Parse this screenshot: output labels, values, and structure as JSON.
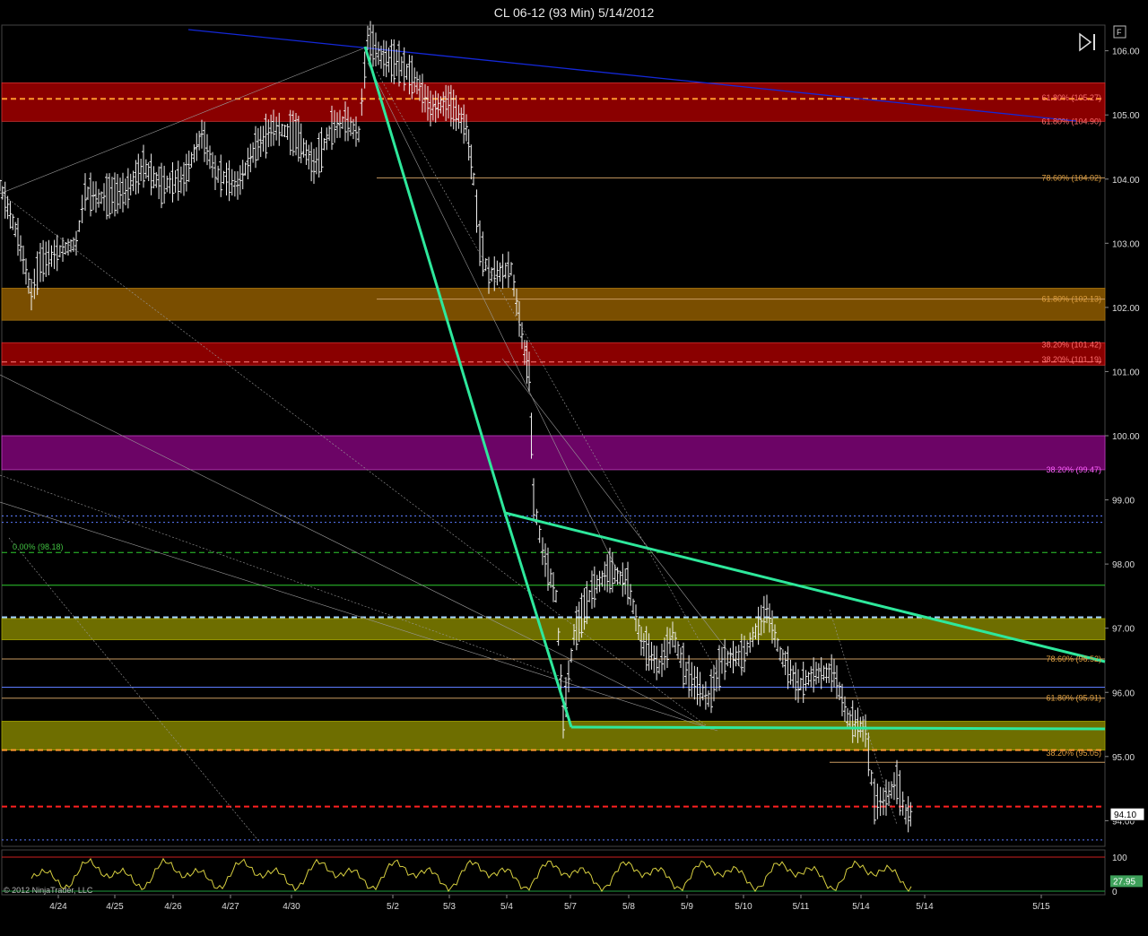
{
  "window": {
    "title": "CL 06-12 (93 Min)  5/14/2012",
    "copyright": "© 2012 NinjaTrader, LLC",
    "price_marker": "94.10",
    "indicator_value": "27.95",
    "f_button": "F"
  },
  "colors": {
    "background": "#000000",
    "bars": "#f0f0f0",
    "green_lines": "#2ee89c",
    "blue_trend": "#1428d8",
    "red_zone": "#8a0000",
    "orange_zone": "#7a4e00",
    "purple_zone": "#6c0466",
    "olive_zone": "#6e6e00",
    "stoch_line": "#d8d040",
    "stoch_extreme": "#3cc8ff"
  },
  "chart_data": {
    "type": "candlestick",
    "title": "CL 06-12 (93 Min)  5/14/2012",
    "ylim": [
      93.6,
      106.4
    ],
    "y_ticks": [
      "106.00",
      "105.00",
      "104.00",
      "103.00",
      "102.00",
      "101.00",
      "100.00",
      "99.00",
      "98.00",
      "97.00",
      "96.00",
      "95.00",
      "94.00"
    ],
    "x_ticks": [
      "4/24",
      "4/25",
      "4/26",
      "4/27",
      "4/30",
      "5/2",
      "5/3",
      "5/4",
      "5/7",
      "5/8",
      "5/9",
      "5/10",
      "5/11",
      "5/14",
      "5/14",
      "5/15"
    ],
    "last_price": 94.1,
    "fib_labels": [
      {
        "text": "61.80% (105.27)",
        "value": 105.27
      },
      {
        "text": "61.80% (104.90)",
        "value": 104.9
      },
      {
        "text": "78.60% (104.02)",
        "value": 104.02
      },
      {
        "text": "61.80% (102.13)",
        "value": 102.13
      },
      {
        "text": "38.20% (101.42)",
        "value": 101.42
      },
      {
        "text": "38.20% (101.19)",
        "value": 101.19
      },
      {
        "text": "38.20% (99.47)",
        "value": 99.47
      },
      {
        "text": "0.00% (98.18)",
        "value": 98.18
      },
      {
        "text": "78.60% (96.52)",
        "value": 96.52
      },
      {
        "text": "61.80% (95.91)",
        "value": 95.91
      },
      {
        "text": "38.20% (95.05)",
        "value": 95.05
      }
    ],
    "zones": [
      {
        "from": 104.9,
        "to": 105.5,
        "color": "red"
      },
      {
        "from": 101.8,
        "to": 102.3,
        "color": "orange"
      },
      {
        "from": 101.1,
        "to": 101.45,
        "color": "red"
      },
      {
        "from": 99.47,
        "to": 100.0,
        "color": "purple"
      },
      {
        "from": 96.82,
        "to": 97.15,
        "color": "olive"
      },
      {
        "from": 95.1,
        "to": 95.55,
        "color": "olive"
      }
    ],
    "horizontal_lines": [
      {
        "value": 105.25,
        "style": "dashed",
        "color": "orange"
      },
      {
        "value": 101.15,
        "style": "dashed",
        "color": "pink"
      },
      {
        "value": 98.75,
        "style": "dotted",
        "color": "blue"
      },
      {
        "value": 98.65,
        "style": "dotted",
        "color": "blue"
      },
      {
        "value": 98.18,
        "style": "dashed",
        "color": "green"
      },
      {
        "value": 97.67,
        "style": "solid",
        "color": "green"
      },
      {
        "value": 97.17,
        "style": "dashed",
        "color": "lightblue"
      },
      {
        "value": 96.52,
        "style": "solid",
        "color": "tan"
      },
      {
        "value": 96.08,
        "style": "solid",
        "color": "blue"
      },
      {
        "value": 95.91,
        "style": "solid",
        "color": "tan"
      },
      {
        "value": 95.1,
        "style": "dashed",
        "color": "orange"
      },
      {
        "value": 94.22,
        "style": "dashed",
        "color": "red"
      },
      {
        "value": 93.7,
        "style": "dotted",
        "color": "blue"
      }
    ],
    "price_path": [
      [
        0,
        103.9
      ],
      [
        20,
        103.1
      ],
      [
        35,
        102.2
      ],
      [
        45,
        102.7
      ],
      [
        70,
        102.9
      ],
      [
        85,
        103.0
      ],
      [
        95,
        103.8
      ],
      [
        110,
        103.7
      ],
      [
        140,
        103.8
      ],
      [
        160,
        104.2
      ],
      [
        180,
        103.9
      ],
      [
        205,
        104.0
      ],
      [
        225,
        104.7
      ],
      [
        240,
        104.1
      ],
      [
        265,
        103.9
      ],
      [
        285,
        104.5
      ],
      [
        305,
        104.8
      ],
      [
        330,
        104.7
      ],
      [
        350,
        104.2
      ],
      [
        370,
        104.8
      ],
      [
        385,
        104.9
      ],
      [
        400,
        104.7
      ],
      [
        410,
        106.2
      ],
      [
        425,
        105.9
      ],
      [
        445,
        105.8
      ],
      [
        465,
        105.5
      ],
      [
        480,
        105.1
      ],
      [
        500,
        105.2
      ],
      [
        520,
        104.8
      ],
      [
        528,
        104.0
      ],
      [
        535,
        103.0
      ],
      [
        545,
        102.5
      ],
      [
        570,
        102.6
      ],
      [
        585,
        101.3
      ],
      [
        590,
        101.0
      ],
      [
        595,
        99.0
      ],
      [
        605,
        98.2
      ],
      [
        620,
        97.5
      ],
      [
        628,
        95.6
      ],
      [
        640,
        96.9
      ],
      [
        660,
        97.6
      ],
      [
        680,
        97.9
      ],
      [
        700,
        97.7
      ],
      [
        715,
        96.8
      ],
      [
        735,
        96.4
      ],
      [
        750,
        96.9
      ],
      [
        765,
        96.3
      ],
      [
        790,
        95.9
      ],
      [
        805,
        96.5
      ],
      [
        830,
        96.6
      ],
      [
        855,
        97.3
      ],
      [
        870,
        96.6
      ],
      [
        890,
        96.1
      ],
      [
        910,
        96.3
      ],
      [
        930,
        96.3
      ],
      [
        945,
        95.6
      ],
      [
        965,
        95.4
      ],
      [
        975,
        94.3
      ],
      [
        985,
        94.3
      ],
      [
        1000,
        94.6
      ],
      [
        1010,
        94.1
      ],
      [
        1018,
        94.1
      ]
    ],
    "indicator": {
      "name": "Stochastics",
      "upper": 100,
      "lower": 0,
      "last": 27.95,
      "ticks": [
        "100",
        "0"
      ]
    }
  }
}
